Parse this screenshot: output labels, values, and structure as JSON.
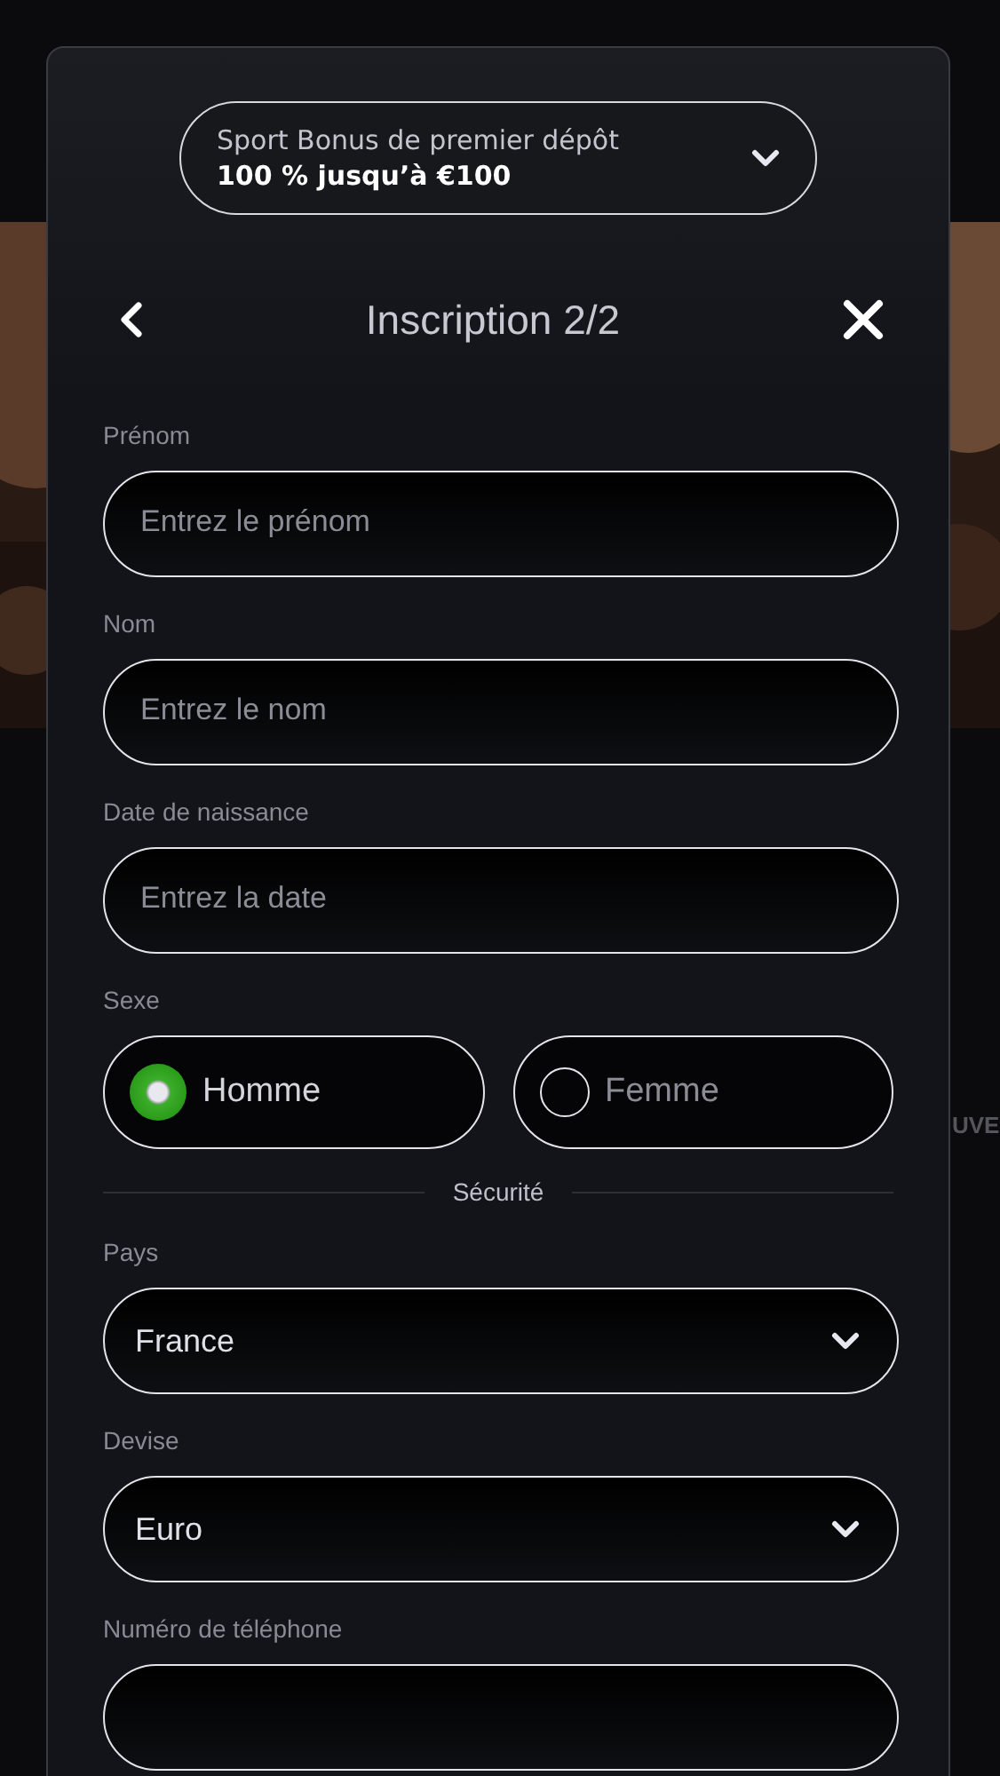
{
  "background_page": {
    "partial_text": "UVE"
  },
  "bonus": {
    "title": "Sport Bonus de premier dépôt",
    "offer": "100 % jusqu’à €100",
    "expanded": false
  },
  "header": {
    "title": "Inscription 2/2"
  },
  "fields": [
    {
      "kind": "text",
      "label": "Prénom",
      "placeholder": "Entrez le prénom"
    },
    {
      "kind": "text",
      "label": "Nom",
      "placeholder": "Entrez le nom"
    },
    {
      "kind": "text",
      "label": "Date de naissance",
      "placeholder": "Entrez la date"
    },
    {
      "kind": "radio",
      "label": "Sexe",
      "options": [
        {
          "label": "Homme",
          "selected": true
        },
        {
          "label": "Femme",
          "selected": false
        }
      ]
    },
    {
      "kind": "divider",
      "label": "Sécurité"
    },
    {
      "kind": "select",
      "label": "Pays",
      "value": "France"
    },
    {
      "kind": "select",
      "label": "Devise",
      "value": "Euro"
    },
    {
      "kind": "text",
      "label": "Numéro de téléphone"
    }
  ]
}
